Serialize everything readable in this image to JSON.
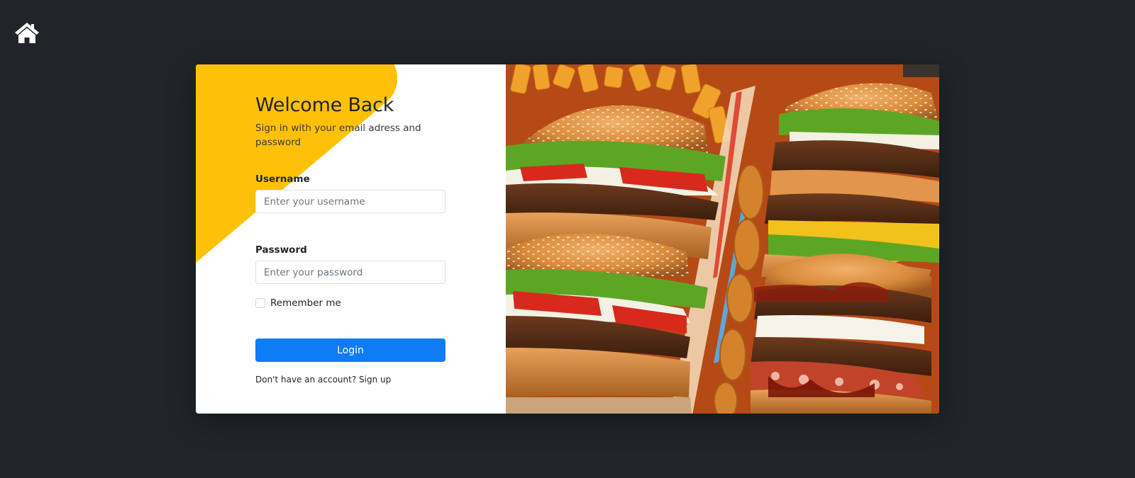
{
  "nav": {
    "home_icon": "home-icon"
  },
  "login": {
    "title": "Welcome Back",
    "subtitle": "Sign in with your email adress and password",
    "username_label": "Username",
    "username_placeholder": "Enter your username",
    "password_label": "Password",
    "password_placeholder": "Enter your password",
    "remember_label": "Remember me",
    "login_button": "Login",
    "signup_prompt": "Don't have an account?",
    "signup_link": "Sign up"
  },
  "colors": {
    "page_background": "#212529",
    "accent_yellow": "#ffc107",
    "primary_blue": "#0d7cf6"
  },
  "hero_image": {
    "subject": "burgers-and-fries-photo"
  }
}
